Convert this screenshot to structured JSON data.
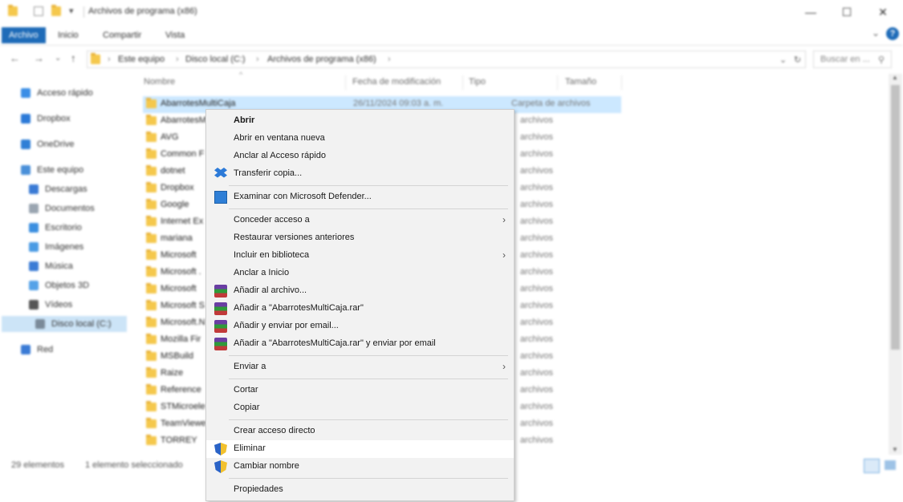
{
  "window": {
    "title": "Archivos de programa (x86)",
    "minimize_glyph": "—",
    "maximize_glyph": "☐",
    "close_glyph": "✕",
    "qa_dropdown_glyph": "▾",
    "help_glyph": "?",
    "expand_ribbon_glyph": "⌄"
  },
  "ribbon": {
    "tabs": [
      "Archivo",
      "Inicio",
      "Compartir",
      "Vista"
    ]
  },
  "address": {
    "back_glyph": "←",
    "forward_glyph": "→",
    "recent_glyph": "⌄",
    "up_glyph": "↑",
    "crumbs": [
      "Este equipo",
      "Disco local (C:)",
      "Archivos de programa (x86)"
    ],
    "crumb_sep": "›",
    "dropdown_glyph": "⌄",
    "refresh_glyph": "↻",
    "search_placeholder": "Buscar en ...",
    "search_glyph": "⚲"
  },
  "nav": {
    "items": [
      {
        "label": "Acceso rápido",
        "icon": "star-icon",
        "color": "#3a8ee6"
      },
      {
        "label": "Dropbox",
        "icon": "dropbox-icon",
        "color": "#2c7ad8"
      },
      {
        "label": "OneDrive",
        "icon": "onedrive-icon",
        "color": "#2f7fd6"
      },
      {
        "label": "Este equipo",
        "icon": "computer-icon",
        "color": "#4a90d9"
      },
      {
        "label": "Descargas",
        "icon": "downloads-icon",
        "color": "#3a7bd5"
      },
      {
        "label": "Documentos",
        "icon": "documents-icon",
        "color": "#9aa5b1"
      },
      {
        "label": "Escritorio",
        "icon": "desktop-icon",
        "color": "#3b8fe0"
      },
      {
        "label": "Imágenes",
        "icon": "pictures-icon",
        "color": "#4a9be4"
      },
      {
        "label": "Música",
        "icon": "music-icon",
        "color": "#3a7bd5"
      },
      {
        "label": "Objetos 3D",
        "icon": "objects3d-icon",
        "color": "#54a2e8"
      },
      {
        "label": "Vídeos",
        "icon": "videos-icon",
        "color": "#555555"
      },
      {
        "label": "Disco local (C:)",
        "icon": "drive-icon",
        "color": "#7a8a99"
      },
      {
        "label": "Red",
        "icon": "network-icon",
        "color": "#3a7bd5"
      }
    ]
  },
  "columns": [
    "Nombre",
    "Fecha de modificación",
    "Tipo",
    "Tamaño"
  ],
  "sort_glyph": "^",
  "files": [
    {
      "name": "AbarrotesMultiCaja",
      "date": "26/11/2024 09:03 a. m.",
      "type": "Carpeta de archivos"
    },
    {
      "name": "AbarrotesM",
      "type": "archivos"
    },
    {
      "name": "AVG",
      "type": "archivos"
    },
    {
      "name": "Common F",
      "type": "archivos"
    },
    {
      "name": "dotnet",
      "type": "archivos"
    },
    {
      "name": "Dropbox",
      "type": "archivos"
    },
    {
      "name": "Google",
      "type": "archivos"
    },
    {
      "name": "Internet Ex",
      "type": "archivos"
    },
    {
      "name": "mariana",
      "type": "archivos"
    },
    {
      "name": "Microsoft",
      "type": "archivos"
    },
    {
      "name": "Microsoft .",
      "type": "archivos"
    },
    {
      "name": "Microsoft ",
      "type": "archivos"
    },
    {
      "name": "Microsoft S",
      "type": "archivos"
    },
    {
      "name": "Microsoft.N",
      "type": "archivos"
    },
    {
      "name": "Mozilla Fir",
      "type": "archivos"
    },
    {
      "name": "MSBuild",
      "type": "archivos"
    },
    {
      "name": "Raize",
      "type": "archivos"
    },
    {
      "name": "Reference",
      "type": "archivos"
    },
    {
      "name": "STMicroele",
      "type": "archivos"
    },
    {
      "name": "TeamViewe",
      "type": "archivos"
    },
    {
      "name": "TORREY",
      "type": "archivos"
    }
  ],
  "status": {
    "count": "29 elementos",
    "selected": "1 elemento seleccionado"
  },
  "context_menu": {
    "items": [
      {
        "label": "Abrir",
        "bold": true
      },
      {
        "label": "Abrir en ventana nueva"
      },
      {
        "label": "Anclar al Acceso rápido"
      },
      {
        "label": "Transferir copia...",
        "icon": "dropbox-icon"
      },
      {
        "separator": true
      },
      {
        "label": "Examinar con Microsoft Defender...",
        "icon": "defender-icon"
      },
      {
        "separator": true
      },
      {
        "label": "Conceder acceso a",
        "submenu": true
      },
      {
        "label": "Restaurar versiones anteriores"
      },
      {
        "label": "Incluir en biblioteca",
        "submenu": true
      },
      {
        "label": "Anclar a Inicio"
      },
      {
        "label": "Añadir al archivo...",
        "icon": "winrar-icon"
      },
      {
        "label": "Añadir a \"AbarrotesMultiCaja.rar\"",
        "icon": "winrar-icon"
      },
      {
        "label": "Añadir y enviar por email...",
        "icon": "winrar-icon"
      },
      {
        "label": "Añadir a \"AbarrotesMultiCaja.rar\" y enviar por email",
        "icon": "winrar-icon"
      },
      {
        "separator": true
      },
      {
        "label": "Enviar a",
        "submenu": true
      },
      {
        "separator": true
      },
      {
        "label": "Cortar"
      },
      {
        "label": "Copiar"
      },
      {
        "separator": true
      },
      {
        "label": "Crear acceso directo"
      },
      {
        "label": "Eliminar",
        "icon": "shield-icon",
        "highlight": true
      },
      {
        "label": "Cambiar nombre",
        "icon": "shield-icon"
      },
      {
        "separator": true
      },
      {
        "label": "Propiedades"
      }
    ],
    "submenu_glyph": "›"
  }
}
